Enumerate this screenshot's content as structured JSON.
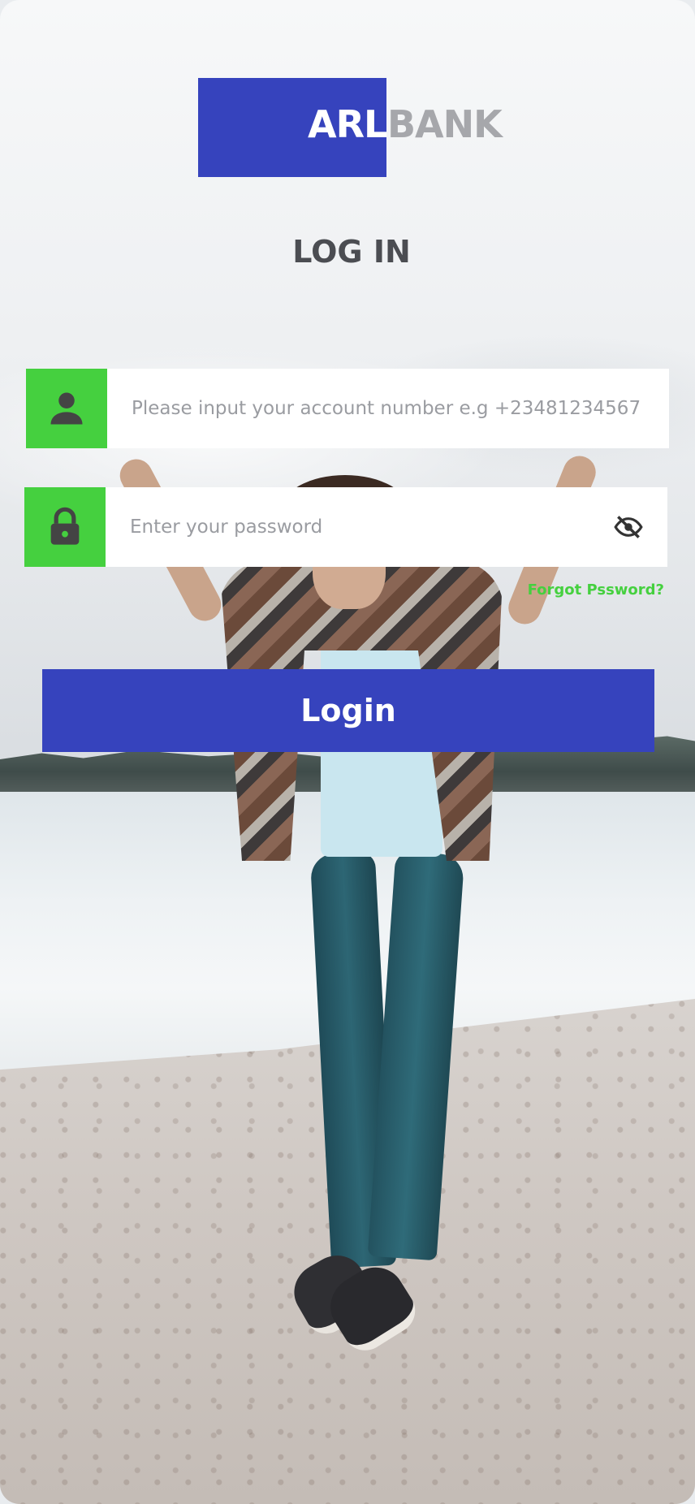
{
  "brand": {
    "name_part1": "ARL",
    "name_part2": "BANK",
    "box_color": "#3643bd",
    "part2_color": "#a6a7ab"
  },
  "page": {
    "title": "LOG IN"
  },
  "form": {
    "account": {
      "icon": "user-icon",
      "placeholder": "Please input your account number e.g +23481234567"
    },
    "password": {
      "icon": "lock-icon",
      "placeholder": "Enter your password",
      "visibility_icon": "eye-off-icon"
    },
    "forgot_label": "Forgot Pssword?",
    "login_label": "Login"
  },
  "colors": {
    "accent_green": "#45d03f",
    "primary_blue": "#3643bd"
  }
}
